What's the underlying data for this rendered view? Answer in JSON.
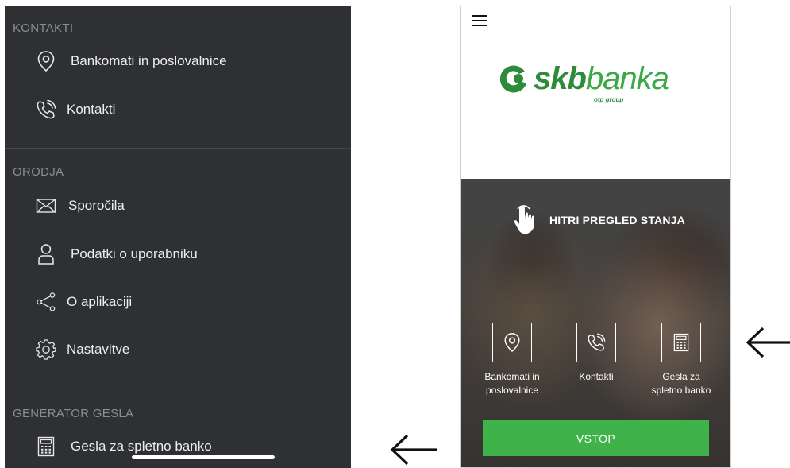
{
  "menu": {
    "sections": [
      {
        "title": "KONTAKTI",
        "items": [
          {
            "label": "Bankomati in poslovalnice",
            "icon": "location-pin-icon"
          },
          {
            "label": "Kontakti",
            "icon": "phone-icon"
          }
        ]
      },
      {
        "title": "ORODJA",
        "items": [
          {
            "label": "Sporočila",
            "icon": "envelope-icon"
          },
          {
            "label": "Podatki o uporabniku",
            "icon": "user-icon"
          },
          {
            "label": "O aplikaciji",
            "icon": "share-icon"
          },
          {
            "label": "Nastavitve",
            "icon": "gear-icon"
          }
        ]
      },
      {
        "title": "GENERATOR GESLA",
        "items": [
          {
            "label": "Gesla za spletno banko",
            "icon": "calculator-icon"
          }
        ]
      }
    ]
  },
  "app": {
    "logo_bold": "skb",
    "logo_light": "banka",
    "logo_sub": "otp group",
    "quick_balance": "HITRI PREGLED STANJA",
    "tiles": [
      {
        "label_line1": "Bankomati in",
        "label_line2": "poslovalnice",
        "icon": "location-pin-icon"
      },
      {
        "label_line1": "Kontakti",
        "label_line2": "",
        "icon": "phone-icon"
      },
      {
        "label_line1": "Gesla za",
        "label_line2": "spletno banko",
        "icon": "calculator-icon"
      }
    ],
    "login_label": "VSTOP"
  },
  "colors": {
    "menu_bg": "#2e3033",
    "brand_green": "#3fb34a",
    "logo_green": "#2e8b3a"
  }
}
